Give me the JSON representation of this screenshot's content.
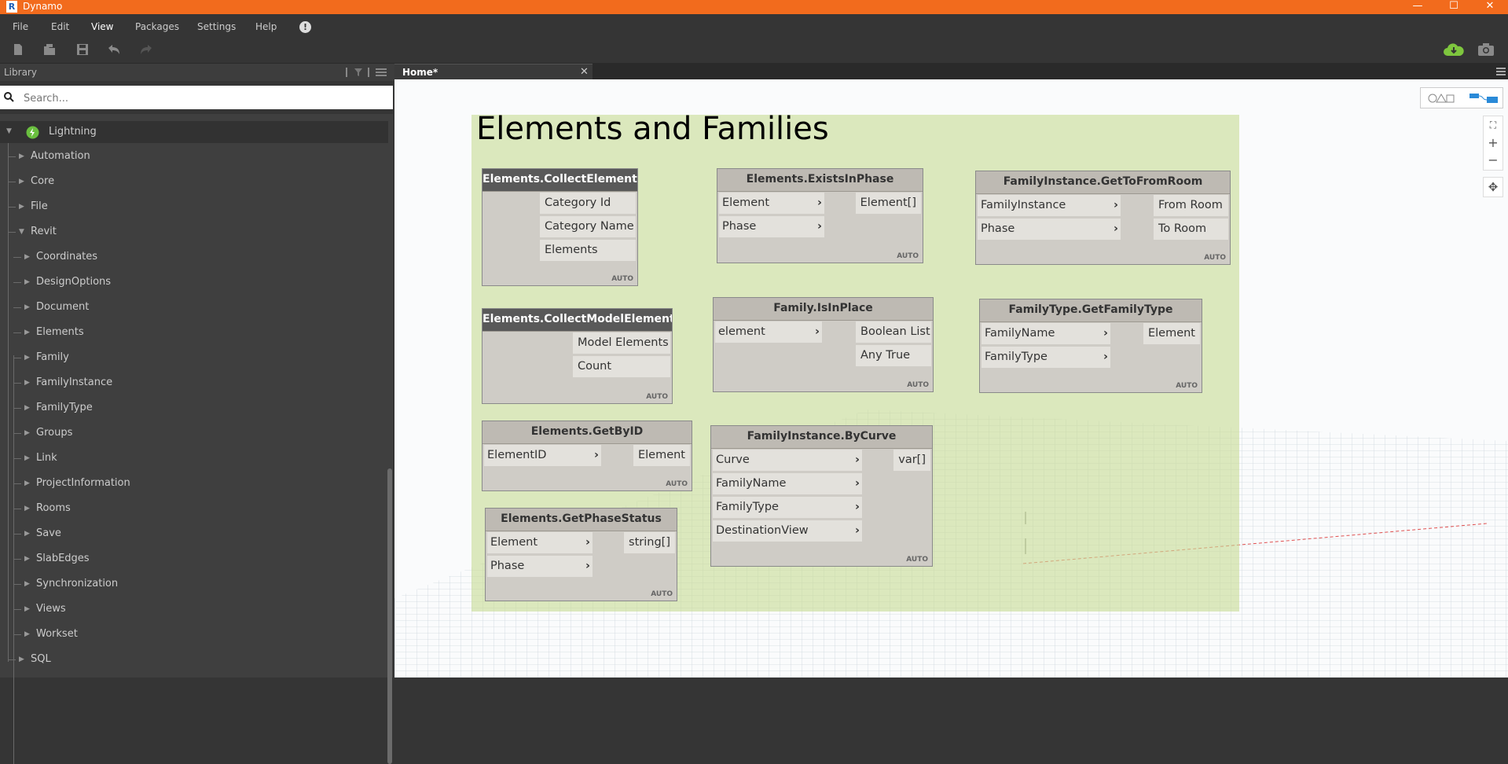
{
  "window": {
    "title": "Dynamo",
    "minimize": "—",
    "maximize": "☐",
    "close": "✕"
  },
  "menu": [
    "File",
    "Edit",
    "View",
    "Packages",
    "Settings",
    "Help"
  ],
  "alert_icon": "!",
  "library": {
    "title": "Library",
    "search_placeholder": "Search...",
    "lightning_label": "Lightning",
    "top_items": [
      "Automation",
      "Core",
      "File",
      "Revit"
    ],
    "revit_children": [
      "Coordinates",
      "DesignOptions",
      "Document",
      "Elements",
      "Family",
      "FamilyInstance",
      "FamilyType",
      "Groups",
      "Link",
      "ProjectInformation",
      "Rooms",
      "Save",
      "SlabEdges",
      "Synchronization",
      "Views",
      "Workset"
    ],
    "bottom_item": "SQL"
  },
  "tab": {
    "label": "Home*",
    "close": "✕"
  },
  "canvas": {
    "group_title": "Elements and Families",
    "auto_label": "AUTO",
    "nodes": [
      {
        "title": "Elements.CollectElements",
        "inputs": [],
        "outputs": [
          "Category Id",
          "Category Name",
          "Elements"
        ]
      },
      {
        "title": "Elements.ExistsInPhase",
        "inputs": [
          "Element",
          "Phase"
        ],
        "outputs": [
          "Element[]"
        ]
      },
      {
        "title": "FamilyInstance.GetToFromRoom",
        "inputs": [
          "FamilyInstance",
          "Phase"
        ],
        "outputs": [
          "From Room",
          "To Room"
        ]
      },
      {
        "title": "Elements.CollectModelElements",
        "inputs": [],
        "outputs": [
          "Model Elements",
          "Count"
        ]
      },
      {
        "title": "Family.IsInPlace",
        "inputs": [
          "element"
        ],
        "outputs": [
          "Boolean List",
          "Any True"
        ]
      },
      {
        "title": "FamilyType.GetFamilyType",
        "inputs": [
          "FamilyName",
          "FamilyType"
        ],
        "outputs": [
          "Element"
        ]
      },
      {
        "title": "Elements.GetByID",
        "inputs": [
          "ElementID"
        ],
        "outputs": [
          "Element"
        ]
      },
      {
        "title": "FamilyInstance.ByCurve",
        "inputs": [
          "Curve",
          "FamilyName",
          "FamilyType",
          "DestinationView"
        ],
        "outputs": [
          "var[]"
        ]
      },
      {
        "title": "Elements.GetPhaseStatus",
        "inputs": [
          "Element",
          "Phase"
        ],
        "outputs": [
          "string[]"
        ]
      }
    ]
  },
  "colors": {
    "titlebar": "#f26b1d",
    "canvas_bg": "#fafbfc",
    "group_bg": "#d5e5b0",
    "node_body": "#cfccc6",
    "node_header": "#bebab3",
    "node_selected_header": "#595959",
    "cloud_icon": "#7ec63e",
    "lightning_icon": "#6abf3f"
  },
  "icons": [
    "new-file-icon",
    "open-file-icon",
    "save-icon",
    "undo-icon",
    "redo-icon",
    "cloud-download-icon",
    "camera-icon",
    "search-icon",
    "filter-icon",
    "layout-icon",
    "lightning-icon",
    "zoom-fit-icon",
    "zoom-in-icon",
    "zoom-out-icon",
    "pan-icon",
    "geometry-view-icon",
    "graph-view-icon"
  ]
}
